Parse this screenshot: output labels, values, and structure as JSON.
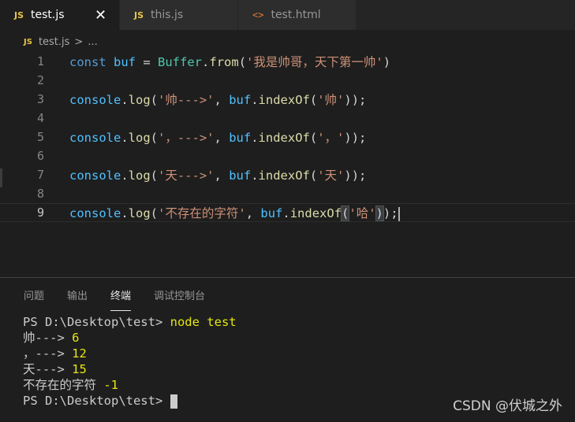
{
  "tabs": [
    {
      "icon": "JS",
      "label": "test.js",
      "active": true,
      "close": "✕"
    },
    {
      "icon": "JS",
      "label": "this.js",
      "active": false
    },
    {
      "icon": "<>",
      "label": "test.html",
      "active": false
    }
  ],
  "breadcrumb": {
    "icon": "JS",
    "file": "test.js",
    "sep": ">",
    "more": "..."
  },
  "editor": {
    "line_numbers": [
      "1",
      "2",
      "3",
      "4",
      "5",
      "6",
      "7",
      "8",
      "9"
    ],
    "code": {
      "l1": {
        "kw": "const",
        "var": "buf",
        "eq": " = ",
        "cls": "Buffer",
        "dot": ".",
        "fn": "from",
        "open": "(",
        "str": "'我是帅哥，天下第一帅'",
        "close": ")"
      },
      "l3": {
        "obj": "console",
        "dot": ".",
        "fn": "log",
        "open": "(",
        "str1": "'帅--->'",
        "comma": ", ",
        "var": "buf",
        "dot2": ".",
        "fn2": "indexOf",
        "open2": "(",
        "str2": "'帅'",
        "close": "));"
      },
      "l5": {
        "obj": "console",
        "dot": ".",
        "fn": "log",
        "open": "(",
        "str1": "'，--->'",
        "comma": ", ",
        "var": "buf",
        "dot2": ".",
        "fn2": "indexOf",
        "open2": "(",
        "str2": "'，'",
        "close": "));"
      },
      "l7": {
        "obj": "console",
        "dot": ".",
        "fn": "log",
        "open": "(",
        "str1": "'天--->'",
        "comma": ", ",
        "var": "buf",
        "dot2": ".",
        "fn2": "indexOf",
        "open2": "(",
        "str2": "'天'",
        "close": "));"
      },
      "l9": {
        "obj": "console",
        "dot": ".",
        "fn": "log",
        "open": "(",
        "str1": "'不存在的字符'",
        "comma": ", ",
        "var": "buf",
        "dot2": ".",
        "fn2": "indexOf",
        "open2": "(",
        "str2": "'哈'",
        "close2": ")",
        "close": ");"
      }
    }
  },
  "panel": {
    "tabs": [
      "问题",
      "输出",
      "终端",
      "调试控制台"
    ],
    "active_tab": "终端",
    "terminal": {
      "prompt1": "PS D:\\Desktop\\test> ",
      "command": "node test",
      "out1_label": "帅---> ",
      "out1_value": "6",
      "out2_label": "，---> ",
      "out2_value": "12",
      "out3_label": "天---> ",
      "out3_value": "15",
      "out4_label": "不存在的字符 ",
      "out4_value": "-1",
      "prompt2": "PS D:\\Desktop\\test> "
    }
  },
  "watermark": "CSDN @伏城之外",
  "colors": {
    "keyword": "#569cd6",
    "variable": "#4fc1ff",
    "class": "#4ec9b0",
    "function": "#dcdcaa",
    "string": "#ce9178",
    "terminal_number": "#e5e510",
    "js_icon": "#e8c347",
    "html_icon": "#e37933"
  }
}
